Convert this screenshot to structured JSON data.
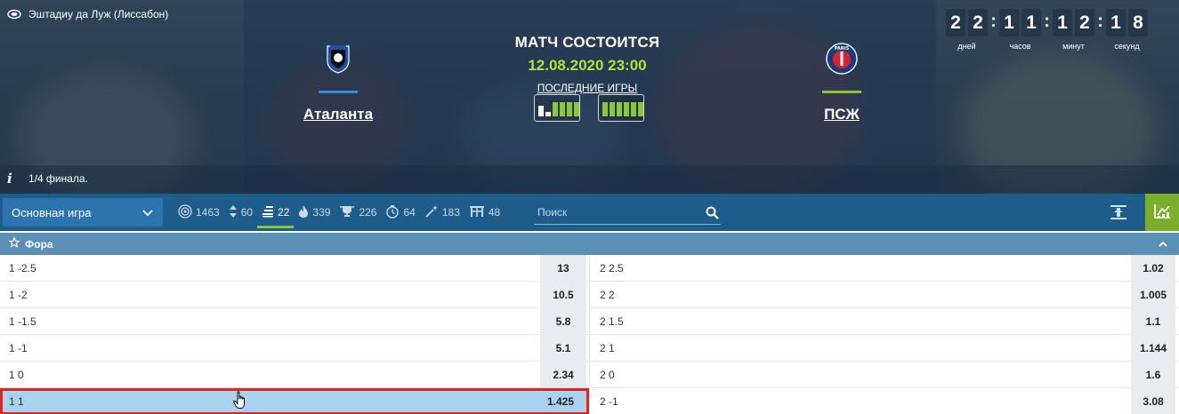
{
  "event": {
    "venue": "Эштадиу да Луж (Лиссабон)",
    "status_title": "МАТЧ СОСТОИТСЯ",
    "datetime": "12.08.2020 23:00",
    "last_games_label": "ПОСЛЕДНИЕ ИГРЫ",
    "round": "1/4 финала.",
    "team_home": {
      "name": "Аталанта",
      "accent": "#2f8fd8",
      "logo": "atalanta-logo"
    },
    "team_away": {
      "name": "ПСЖ",
      "accent": "#8cc63f",
      "logo": "psg-logo"
    },
    "home_form": [
      "D",
      "L",
      "W",
      "W",
      "W",
      "W"
    ],
    "away_form": [
      "W",
      "W",
      "W",
      "W",
      "W",
      "W"
    ]
  },
  "countdown": {
    "days": [
      "2",
      "2"
    ],
    "hours": [
      "1",
      "1"
    ],
    "minutes": [
      "1",
      "2"
    ],
    "seconds": [
      "1",
      "8"
    ],
    "days_label": "дней",
    "hours_label": "часов",
    "minutes_label": "минут",
    "seconds_label": "секунд"
  },
  "toolbar": {
    "market_select": "Основная игра",
    "filters": [
      {
        "icon": "target-icon",
        "count": "1463"
      },
      {
        "icon": "updown-icon",
        "count": "60"
      },
      {
        "icon": "list-icon",
        "count": "22"
      },
      {
        "icon": "fire-icon",
        "count": "339"
      },
      {
        "icon": "trophy-icon",
        "count": "226"
      },
      {
        "icon": "timer-icon",
        "count": "64"
      },
      {
        "icon": "wand-icon",
        "count": "183"
      },
      {
        "icon": "gate-icon",
        "count": "48"
      }
    ],
    "active_filter": "22",
    "search_placeholder": "Поиск"
  },
  "market": {
    "title": "Фора",
    "rows": [
      {
        "left_label": "1 -2.5",
        "left_odd": "13",
        "right_label": "2 2.5",
        "right_odd": "1.02"
      },
      {
        "left_label": "1 -2",
        "left_odd": "10.5",
        "right_label": "2 2",
        "right_odd": "1.005"
      },
      {
        "left_label": "1 -1.5",
        "left_odd": "5.8",
        "right_label": "2 1.5",
        "right_odd": "1.1"
      },
      {
        "left_label": "1 -1",
        "left_odd": "5.1",
        "right_label": "2 1",
        "right_odd": "1.144"
      },
      {
        "left_label": "1 0",
        "left_odd": "2.34",
        "right_label": "2 0",
        "right_odd": "1.6"
      },
      {
        "left_label": "1 1",
        "left_odd": "1.425",
        "right_label": "2 -1",
        "right_odd": "3.08"
      }
    ],
    "highlight_color": "#e2231a"
  }
}
